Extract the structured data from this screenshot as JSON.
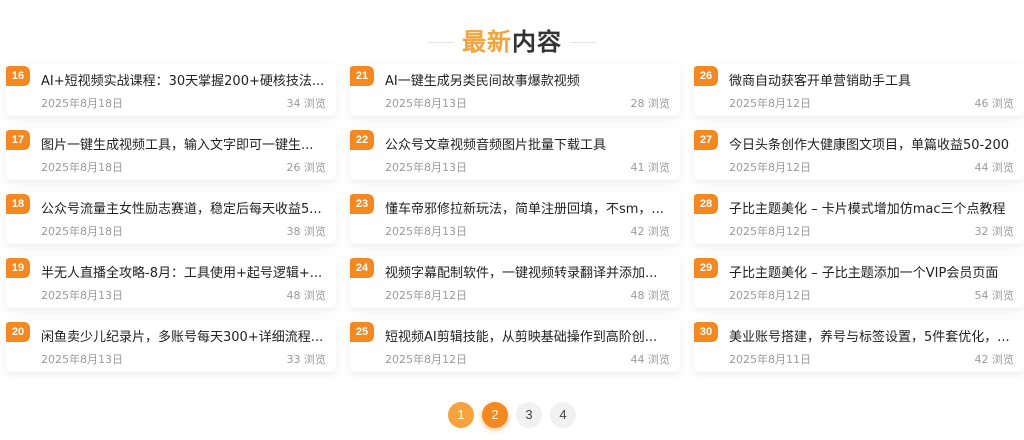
{
  "section": {
    "title_highlight": "最新",
    "title_rest": "内容"
  },
  "colors": {
    "accent": "#f5891f",
    "accent_light": "#f7a23a"
  },
  "views_suffix": "浏览",
  "cards": [
    {
      "num": "16",
      "title": "AI+短视频实战课程：30天掌握200+硬核技法...",
      "date": "2025年8月18日",
      "views": "34 浏览"
    },
    {
      "num": "17",
      "title": "图片一键生成视频工具，输入文字即可一键生...",
      "date": "2025年8月18日",
      "views": "26 浏览"
    },
    {
      "num": "18",
      "title": "公众号流量主女性励志赛道，稳定后每天收益5...",
      "date": "2025年8月18日",
      "views": "38 浏览"
    },
    {
      "num": "19",
      "title": "半无人直播全攻略-8月：工具使用+起号逻辑+...",
      "date": "2025年8月13日",
      "views": "48 浏览"
    },
    {
      "num": "20",
      "title": "闲鱼卖少儿纪录片，多账号每天300+详细流程...",
      "date": "2025年8月13日",
      "views": "33 浏览"
    },
    {
      "num": "21",
      "title": "AI一键生成另类民间故事爆款视频",
      "date": "2025年8月13日",
      "views": "28 浏览"
    },
    {
      "num": "22",
      "title": "公众号文章视频音频图片批量下载工具",
      "date": "2025年8月13日",
      "views": "41 浏览"
    },
    {
      "num": "23",
      "title": "懂车帝邪修拉新玩法，简单注册回填，不sm，...",
      "date": "2025年8月13日",
      "views": "42 浏览"
    },
    {
      "num": "24",
      "title": "视频字幕配制软件，一键视频转录翻译并添加...",
      "date": "2025年8月12日",
      "views": "48 浏览"
    },
    {
      "num": "25",
      "title": "短视频AI剪辑技能，从剪映基础操作到高阶创...",
      "date": "2025年8月12日",
      "views": "44 浏览"
    },
    {
      "num": "26",
      "title": "微商自动获客开单营销助手工具",
      "date": "2025年8月12日",
      "views": "46 浏览"
    },
    {
      "num": "27",
      "title": "今日头条创作大健康图文项目，单篇收益50-200",
      "date": "2025年8月12日",
      "views": "44 浏览"
    },
    {
      "num": "28",
      "title": "子比主题美化 – 卡片模式增加仿mac三个点教程",
      "date": "2025年8月12日",
      "views": "32 浏览"
    },
    {
      "num": "29",
      "title": "子比主题美化 – 子比主题添加一个VIP会员页面",
      "date": "2025年8月12日",
      "views": "54 浏览"
    },
    {
      "num": "30",
      "title": "美业账号搭建，养号与标签设置，5件套优化，...",
      "date": "2025年8月11日",
      "views": "42 浏览"
    }
  ],
  "pagination": [
    "1",
    "2",
    "3",
    "4"
  ]
}
